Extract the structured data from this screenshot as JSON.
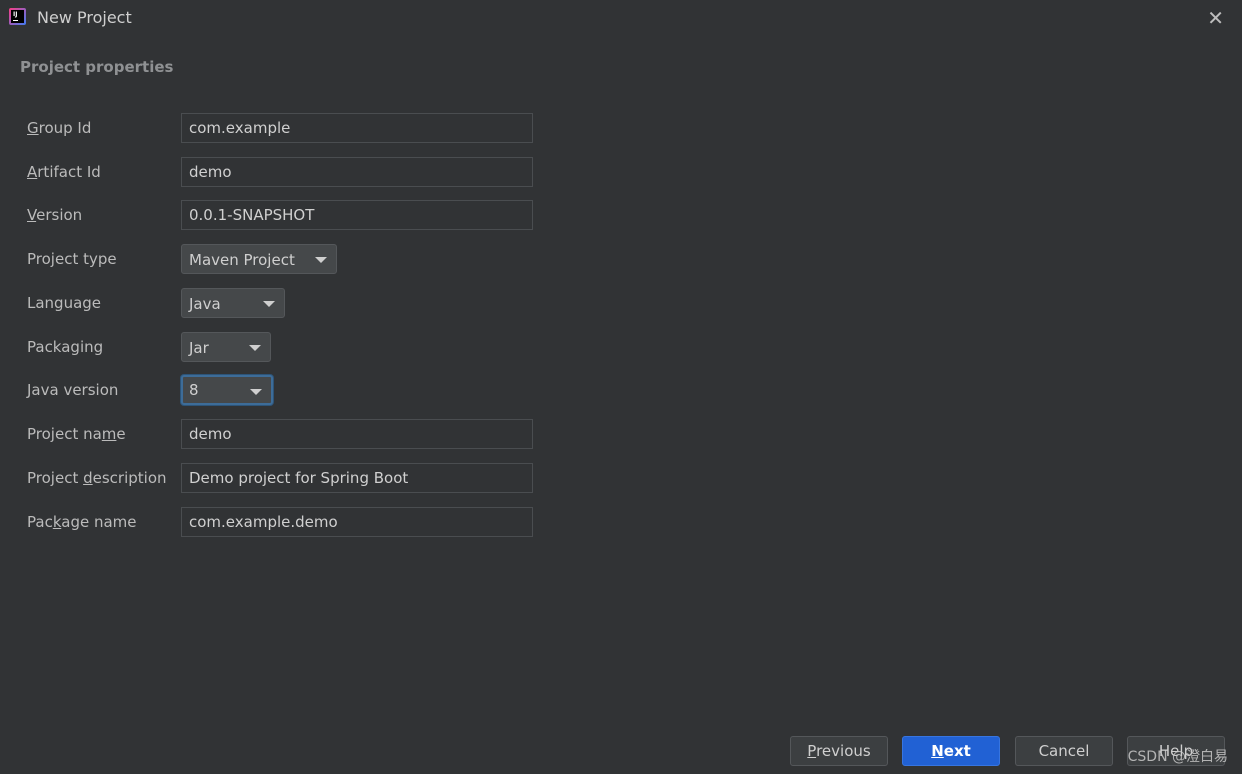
{
  "window": {
    "title": "New Project",
    "close_icon": "close-icon"
  },
  "section_title": "Project properties",
  "fields": [
    {
      "label": "Group Id",
      "mnemonic": "G",
      "value": "com.example",
      "type": "text"
    },
    {
      "label": "Artifact Id",
      "mnemonic": "A",
      "value": "demo",
      "type": "text"
    },
    {
      "label": "Version",
      "mnemonic": "V",
      "value": "0.0.1-SNAPSHOT",
      "type": "text"
    },
    {
      "label": "Project type",
      "value": "Maven Project",
      "type": "select"
    },
    {
      "label": "Language",
      "value": "Java",
      "type": "select"
    },
    {
      "label": "Packaging",
      "value": "Jar",
      "type": "select"
    },
    {
      "label": "Java version",
      "value": "8",
      "type": "select",
      "focused": true
    },
    {
      "label": "Project name",
      "mnemonic": "m",
      "value": "demo",
      "type": "text"
    },
    {
      "label": "Project description",
      "mnemonic": "d",
      "value": "Demo project for Spring Boot",
      "type": "text"
    },
    {
      "label": "Package name",
      "mnemonic": "k",
      "value": "com.example.demo",
      "type": "text"
    }
  ],
  "buttons": {
    "previous": "Previous",
    "next": "Next",
    "cancel": "Cancel",
    "help": "Help"
  },
  "watermark": "CSDN @澄白易",
  "colors": {
    "background": "#313335",
    "primary": "#2161d4",
    "focus": "#3d6c98"
  }
}
